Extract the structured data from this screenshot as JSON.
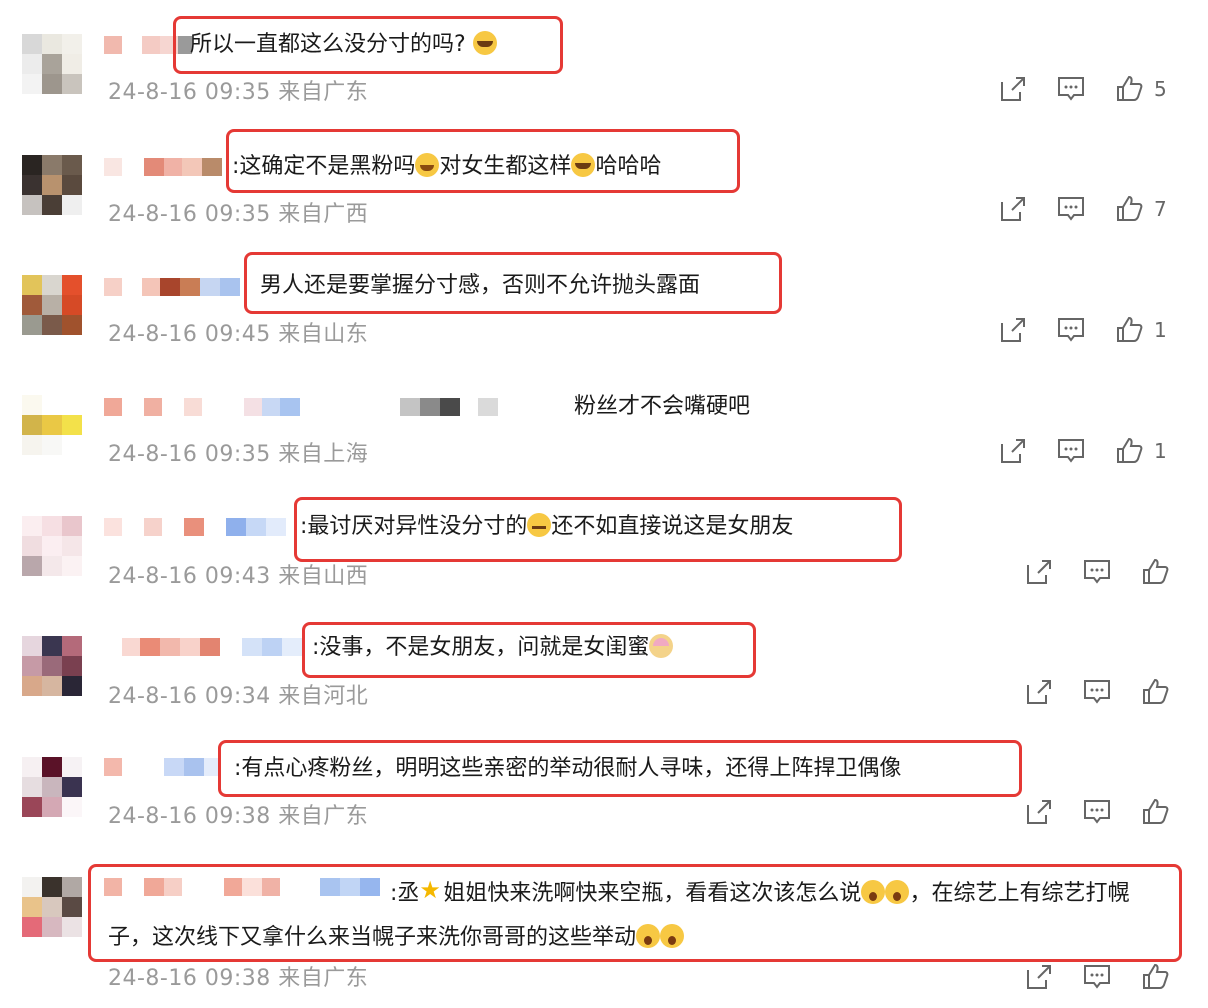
{
  "comments": [
    {
      "text": "所以一直都这么没分寸的吗?",
      "emojis": [
        "crying-laughing"
      ],
      "timestamp": "24-8-16 09:35 来自广东",
      "likes": "5"
    },
    {
      "text_parts": [
        ":这确定不是黑粉吗",
        "对女生都这样",
        "哈哈哈"
      ],
      "timestamp": "24-8-16 09:35 来自广西",
      "likes": "7"
    },
    {
      "text": "男人还是要掌握分寸感，否则不允许抛头露面",
      "timestamp": "24-8-16 09:45 来自山东",
      "likes": "1"
    },
    {
      "text": "粉丝才不会嘴硬吧",
      "timestamp": "24-8-16 09:35 来自上海",
      "likes": "1"
    },
    {
      "text_parts": [
        ":最讨厌对异性没分寸的",
        "还不如直接说这是女朋友"
      ],
      "timestamp": "24-8-16 09:43 来自山西",
      "likes": ""
    },
    {
      "text": ":没事，不是女朋友，问就是女闺蜜",
      "timestamp": "24-8-16 09:34 来自河北",
      "likes": ""
    },
    {
      "text": ":有点心疼粉丝，明明这些亲密的举动很耐人寻味，还得上阵捍卫偶像",
      "timestamp": "24-8-16 09:38 来自广东",
      "likes": ""
    },
    {
      "text_parts": [
        ":丞",
        "姐姐快来洗啊快来空瓶，看看这次该怎么说",
        "，在综艺上有综",
        "艺打幌子，这次线下又拿什么来当幌子来洗你哥哥的这些举动"
      ],
      "timestamp": "24-8-16 09:38 来自广东",
      "likes": ""
    }
  ],
  "colors": {
    "highlight": "#e53935",
    "meta": "#9a9a9a"
  },
  "icons": [
    "share-icon",
    "comment-icon",
    "like-icon"
  ]
}
